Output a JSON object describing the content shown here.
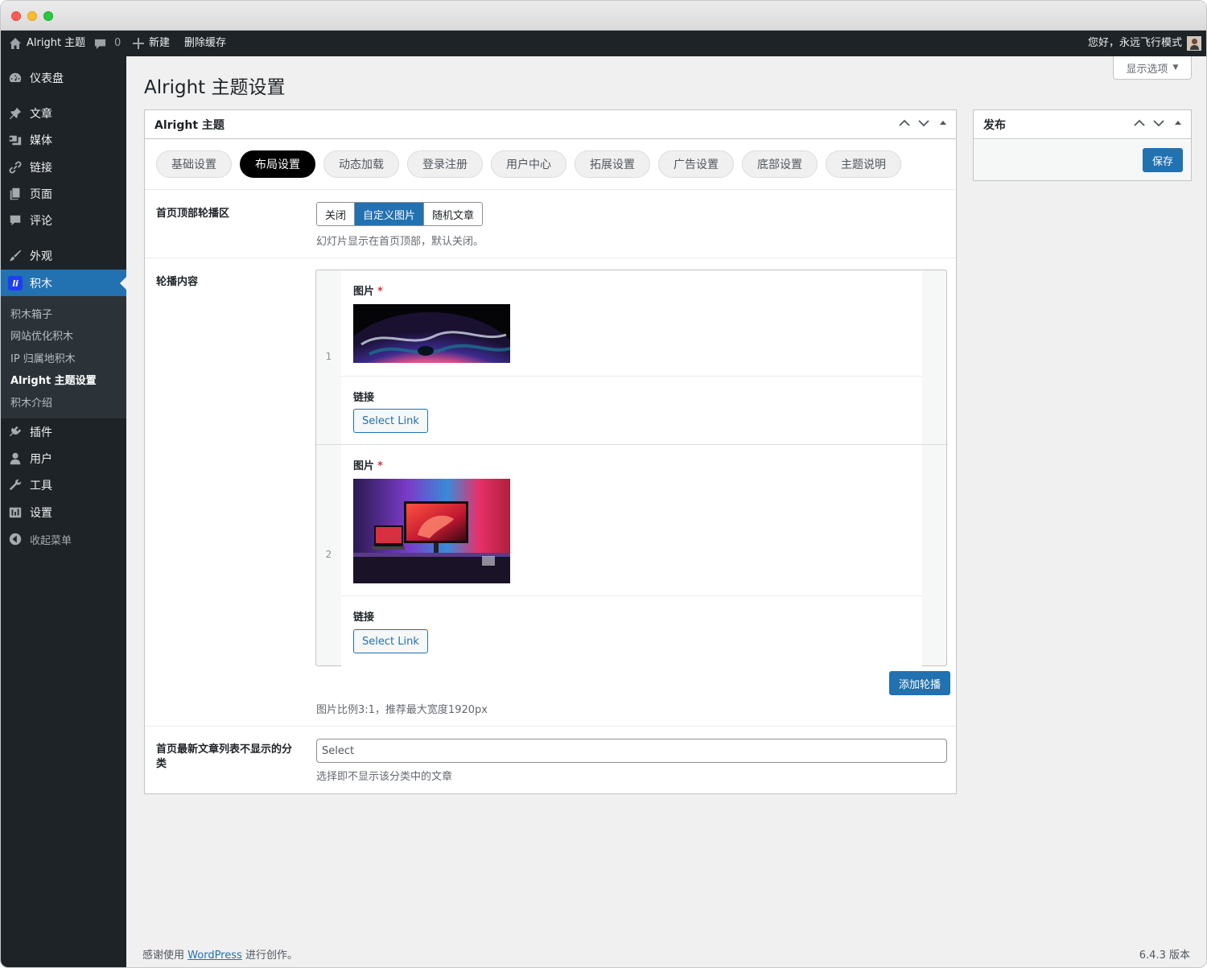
{
  "adminbar": {
    "site_name": "Alright 主题",
    "comments_count": "0",
    "new_label": "新建",
    "clear_cache_label": "删除缓存",
    "greeting": "您好，永远飞行模式"
  },
  "sidebar": {
    "dashboard": "仪表盘",
    "posts": "文章",
    "media": "媒体",
    "links": "链接",
    "pages": "页面",
    "comments": "评论",
    "appearance": "外观",
    "jimu": "积木",
    "jimu_icon_text": "li",
    "submenu": [
      "积木箱子",
      "网站优化积木",
      "IP 归属地积木",
      "Alright 主题设置",
      "积木介绍"
    ],
    "plugins": "插件",
    "users": "用户",
    "tools": "工具",
    "settings": "设置",
    "collapse": "收起菜单"
  },
  "screen_options": "显示选项",
  "page_title": "Alright 主题设置",
  "main_box": {
    "title": "Alright 主题",
    "tabs": [
      "基础设置",
      "布局设置",
      "动态加载",
      "登录注册",
      "用户中心",
      "拓展设置",
      "广告设置",
      "底部设置",
      "主题说明"
    ],
    "active_tab": "布局设置"
  },
  "slider_area": {
    "label": "首页顶部轮播区",
    "options": [
      "关闭",
      "自定义图片",
      "随机文章"
    ],
    "selected": "自定义图片",
    "description": "幻灯片显示在首页顶部，默认关闭。"
  },
  "slider_content": {
    "label": "轮播内容",
    "items": [
      {
        "index": "1",
        "image_label": "图片",
        "required_mark": "*",
        "link_label": "链接",
        "link_button": "Select Link"
      },
      {
        "index": "2",
        "image_label": "图片",
        "required_mark": "*",
        "link_label": "链接",
        "link_button": "Select Link"
      }
    ],
    "add_button": "添加轮播",
    "description": "图片比例3:1，推荐最大宽度1920px"
  },
  "exclude_categories": {
    "label": "首页最新文章列表不显示的分类",
    "placeholder": "Select",
    "description": "选择即不显示该分类中的文章"
  },
  "publish_box": {
    "title": "发布",
    "save_button": "保存"
  },
  "footer": {
    "thanks_prefix": "感谢使用",
    "wordpress_link": "WordPress",
    "thanks_suffix": "进行创作。",
    "version": "6.4.3 版本"
  },
  "colors": {
    "admin_dark": "#1d2327",
    "accent": "#2271b1",
    "background": "#f0f0f1"
  }
}
